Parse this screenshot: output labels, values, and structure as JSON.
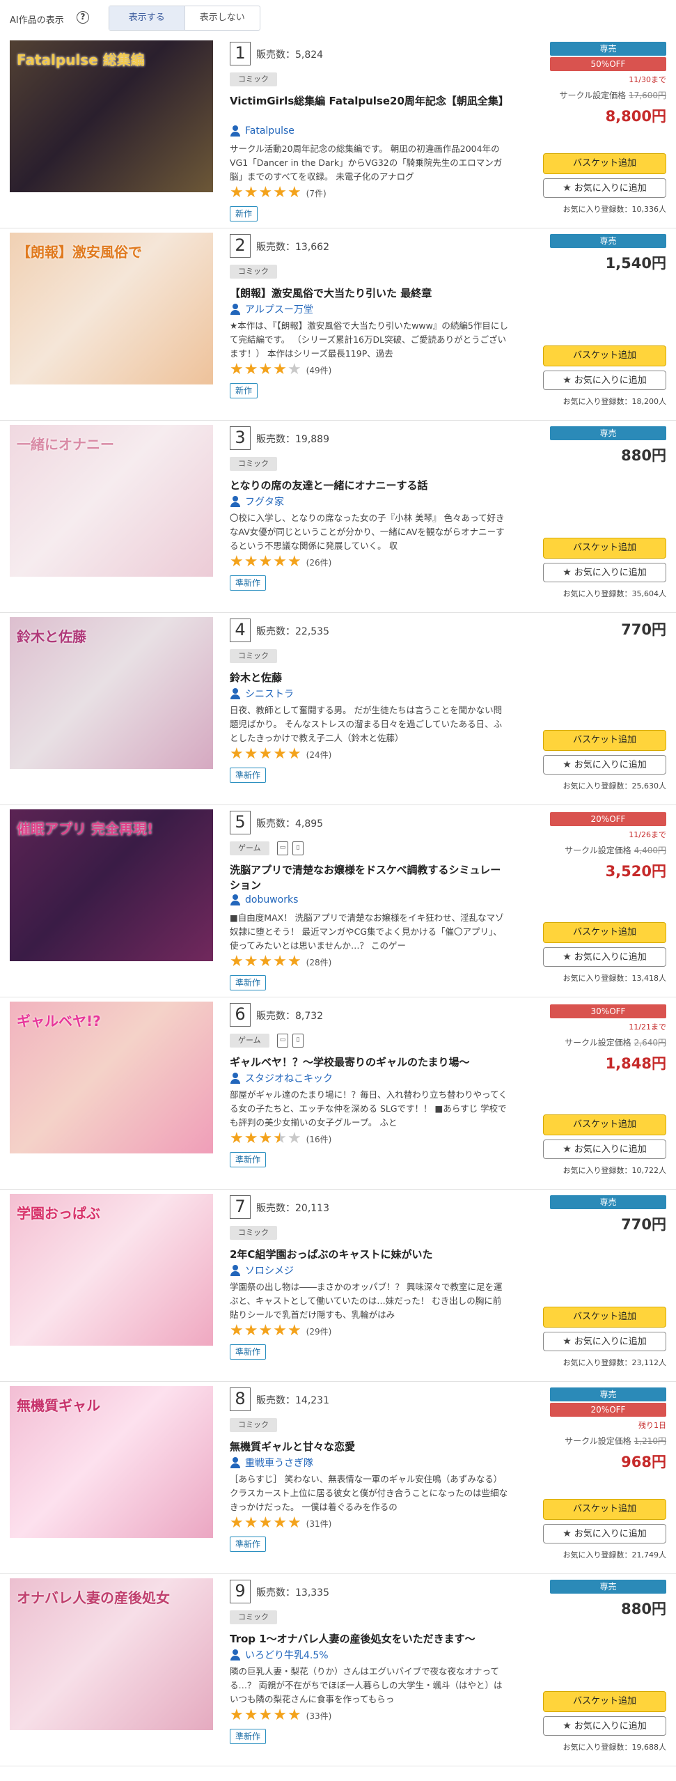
{
  "header": {
    "ai_label": "AI作品の表示",
    "help_glyph": "?",
    "toggle_show": "表示する",
    "toggle_hide": "表示しない"
  },
  "labels": {
    "sales_prefix": "販売数：",
    "exclusive": "専売",
    "basket": "バスケット追加",
    "favorite": "お気に入りに追加",
    "orig_label": "サークル設定価格",
    "fav_prefix": "お気に入り登録数："
  },
  "colors": {
    "accent_blue": "#2b8ab8",
    "sale_red": "#d9534f",
    "star_orange": "#f3a21b",
    "basket_yellow": "#ffd43b"
  },
  "items": [
    {
      "rank": "1",
      "sales": "5,824",
      "category": "コミック",
      "category_icons": [],
      "title": "VictimGirls総集編 Fatalpulse20周年記念【朝凪全集】",
      "circle": "Fatalpulse",
      "description": "サークル活動20周年記念の総集編です。 朝凪の初違画作品2004年のVG1「Dancer in the Dark」からVG32の「騎乗院先生のエロマンガ脳」までのすべてを収録。 未電子化のアナログ",
      "rating": 5,
      "reviews": "(7件)",
      "tag": "新作",
      "exclusive": true,
      "discount": "50%OFF",
      "deadline": "11/30まで",
      "orig_price": "17,600円",
      "price": "8,800円",
      "favorites": "10,336人",
      "thumb_color": "#2a1f2d",
      "thumb_accent": "#f2c94c",
      "thumb_text": "Fatalpulse 総集編"
    },
    {
      "rank": "2",
      "sales": "13,662",
      "category": "コミック",
      "category_icons": [],
      "title": "【朗報】激安風俗で大当たり引いた 最終章",
      "circle": "アルプスー万堂",
      "description": "★本作は、『【朗報】激安風俗で大当たり引いたwww』の続編5作目にして完結編です。 （シリーズ累計16万DL突破、ご愛読ありがとうございます！） 本作はシリーズ最長119P、過去",
      "rating": 4,
      "reviews": "(49件)",
      "tag": "新作",
      "exclusive": true,
      "discount": "",
      "deadline": "",
      "orig_price": "",
      "price": "1,540円",
      "favorites": "18,200人",
      "thumb_color": "#f5e6d8",
      "thumb_accent": "#e07a1f",
      "thumb_text": "【朗報】激安風俗で"
    },
    {
      "rank": "3",
      "sales": "19,889",
      "category": "コミック",
      "category_icons": [],
      "title": "となりの席の友達と一緒にオナニーする話",
      "circle": "フグタ家",
      "description": "〇校に入学し、となりの席なった女の子『小林 美琴』 色々あって好きなAV女優が同じということが分かり、一緒にAVを観ながらオナニーするという不思議な関係に発展していく。 収",
      "rating": 5,
      "reviews": "(26件)",
      "tag": "準新作",
      "exclusive": true,
      "discount": "",
      "deadline": "",
      "orig_price": "",
      "price": "880円",
      "favorites": "35,604人",
      "thumb_color": "#f6ecef",
      "thumb_accent": "#d98aa5",
      "thumb_text": "一緒にオナニー"
    },
    {
      "rank": "4",
      "sales": "22,535",
      "category": "コミック",
      "category_icons": [],
      "title": "鈴木と佐藤",
      "circle": "シニストラ",
      "description": "日夜、教師として奮闘する男。 だが生徒たちは言うことを聞かない問題児ばかり。 そんなストレスの溜まる日々を過ごしていたある日、ふとしたきっかけで教え子二人（鈴木と佐藤）",
      "rating": 5,
      "reviews": "(24件)",
      "tag": "準新作",
      "exclusive": false,
      "discount": "",
      "deadline": "",
      "orig_price": "",
      "price": "770円",
      "favorites": "25,630人",
      "thumb_color": "#e8e0e4",
      "thumb_accent": "#b03a7a",
      "thumb_text": "鈴木と佐藤"
    },
    {
      "rank": "5",
      "sales": "4,895",
      "category": "ゲーム",
      "category_icons": [
        "PC",
        "SP"
      ],
      "title": "洗脳アプリで清楚なお嬢様をドスケベ調教するシミュレーション",
      "circle": "dobuworks",
      "description": "■自由度MAX！ 洗脳アプリで清楚なお嬢様をイキ狂わせ、淫乱なマゾ奴隷に堕とそう！ 最近マンガやCG集でよく見かける「催〇アプリ」、使ってみたいとは思いませんか…？ このゲー",
      "rating": 5,
      "reviews": "(28件)",
      "tag": "準新作",
      "exclusive": false,
      "discount": "20%OFF",
      "deadline": "11/26まで",
      "orig_price": "4,400円",
      "price": "3,520円",
      "favorites": "13,418人",
      "thumb_color": "#3a1c46",
      "thumb_accent": "#e0418a",
      "thumb_text": "催眠アプリ 完全再現!"
    },
    {
      "rank": "6",
      "sales": "8,732",
      "category": "ゲーム",
      "category_icons": [
        "PC",
        "SP"
      ],
      "title": "ギャルベヤ！？～学校最寄りのギャルのたまり場～",
      "circle": "スタジオねこキック",
      "description": "部屋がギャル達のたまり場に！？毎日、入れ替わり立ち替わりやってくる女の子たちと、エッチな仲を深める SLGです！！ ■あらすじ 学校でも評判の美少女揃いの女子グループ。 ふと",
      "rating": 3.5,
      "reviews": "(16件)",
      "tag": "準新作",
      "exclusive": false,
      "discount": "30%OFF",
      "deadline": "11/21まで",
      "orig_price": "2,640円",
      "price": "1,848円",
      "favorites": "10,722人",
      "thumb_color": "#f4d2c8",
      "thumb_accent": "#e8369a",
      "thumb_text": "ギャルベヤ!?"
    },
    {
      "rank": "7",
      "sales": "20,113",
      "category": "コミック",
      "category_icons": [],
      "title": "2年C組学園おっぱぶのキャストに妹がいた",
      "circle": "ソロシメジ",
      "description": "学園祭の出し物は――まさかのオッパブ！？ 興味深々で教室に足を運ぶと、キャストとして働いていたのは…妹だった！ むき出しの胸に前貼りシールで乳首だけ隠すも、乳輪がはみ",
      "rating": 5,
      "reviews": "(29件)",
      "tag": "準新作",
      "exclusive": true,
      "discount": "",
      "deadline": "",
      "orig_price": "",
      "price": "770円",
      "favorites": "23,112人",
      "thumb_color": "#fbe3ec",
      "thumb_accent": "#d8336a",
      "thumb_text": "学園おっぱぶ"
    },
    {
      "rank": "8",
      "sales": "14,231",
      "category": "コミック",
      "category_icons": [],
      "title": "無機質ギャルと甘々な恋愛",
      "circle": "重戦車うさぎ隊",
      "description": "［あらすじ］ 笑わない、無表情な一軍のギャル安住鳴（あずみなる） クラスカースト上位に居る彼女と僕が付き合うことになったのは些細なきっかけだった。 一僕は着ぐるみを作るの",
      "rating": 5,
      "reviews": "(31件)",
      "tag": "準新作",
      "exclusive": true,
      "discount": "20%OFF",
      "deadline": "残り1日",
      "orig_price": "1,210円",
      "price": "968円",
      "favorites": "21,749人",
      "thumb_color": "#fde1ee",
      "thumb_accent": "#c7326b",
      "thumb_text": "無機質ギャル"
    },
    {
      "rank": "9",
      "sales": "13,335",
      "category": "コミック",
      "category_icons": [],
      "title": "Trop 1～オナバレ人妻の産後処女をいただきます～",
      "circle": "いろどり牛乳4.5%",
      "description": "隣の巨乳人妻・梨花（りか）さんはエグいバイブで夜な夜なオナってる…？ 両親が不在がちでほぼ一人暮らしの大学生・颯斗（はやと）はいつも隣の梨花さんに食事を作ってもらっ",
      "rating": 5,
      "reviews": "(33件)",
      "tag": "準新作",
      "exclusive": true,
      "discount": "",
      "deadline": "",
      "orig_price": "",
      "price": "880円",
      "favorites": "19,688人",
      "thumb_color": "#f7dfe8",
      "thumb_accent": "#c0406e",
      "thumb_text": "オナバレ人妻の産後処女"
    }
  ]
}
